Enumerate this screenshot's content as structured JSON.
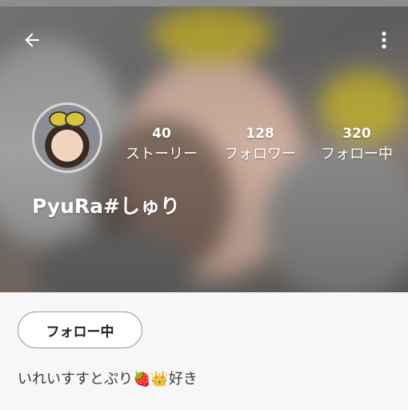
{
  "header": {
    "back_icon": "back-arrow-icon",
    "more_icon": "more-vertical-icon"
  },
  "profile": {
    "username": "PyuRa#しゅり",
    "stats": [
      {
        "value": "40",
        "label": "ストーリー"
      },
      {
        "value": "128",
        "label": "フォロワー"
      },
      {
        "value": "320",
        "label": "フォロー中"
      }
    ],
    "follow_button_label": "フォロー中",
    "bio": "いれいすすとぷり🍓👑好き"
  },
  "colors": {
    "header_text": "#ffffff",
    "page_background": "#f7f7f7",
    "button_border": "#9a9a9a"
  }
}
